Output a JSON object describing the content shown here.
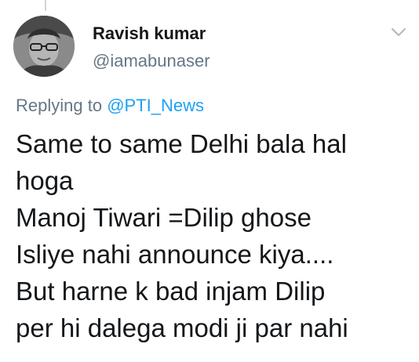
{
  "thread": {
    "connector": true
  },
  "author": {
    "name": "Ravish kumar",
    "handle": "@iamabunaser",
    "avatar_icon": "profile-photo"
  },
  "menu": {
    "icon": "chevron-down-icon"
  },
  "reply": {
    "prefix": "Replying to",
    "mention": "@PTI_News"
  },
  "tweet": {
    "lines": [
      "Same to same Delhi bala hal",
      "hoga",
      "Manoj Tiwari =Dilip ghose",
      "Isliye nahi announce kiya....",
      "But harne k bad injam Dilip",
      "per hi dalega modi ji par nahi"
    ]
  },
  "colors": {
    "text": "#14171a",
    "secondary": "#657786",
    "link": "#1da1f2",
    "divider": "#ccd6dd"
  }
}
